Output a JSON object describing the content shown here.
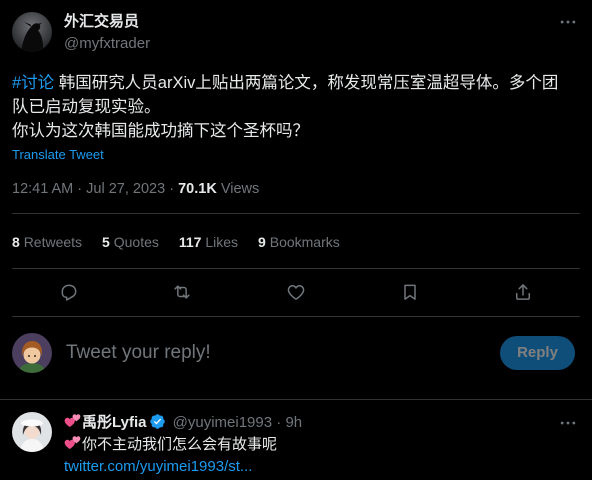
{
  "colors": {
    "background": "#000000",
    "text": "#e7e9ea",
    "secondary": "#71767b",
    "accent": "#1d9bf0",
    "divider": "#2f3336"
  },
  "author": {
    "avatar_icon": "profile-avatar",
    "display_name": "外汇交易员",
    "handle": "@myfxtrader",
    "more_icon": "more-options-icon"
  },
  "tweet": {
    "hashtag": "#讨论",
    "lines": [
      "韩国研究人员arXiv上贴出两篇论文，称发现常压室温超导体。多个团",
      "队已启动复现实验。",
      "你认为这次韩国能成功摘下这个圣杯吗？"
    ],
    "translate_label": "Translate Tweet",
    "time": "12:41 AM",
    "separator": "·",
    "date": "Jul 27, 2023",
    "views_count": "70.1K",
    "views_label": "Views"
  },
  "stats": [
    {
      "count": "8",
      "label": "Retweets"
    },
    {
      "count": "5",
      "label": "Quotes"
    },
    {
      "count": "117",
      "label": "Likes"
    },
    {
      "count": "9",
      "label": "Bookmarks"
    }
  ],
  "actions": [
    "reply-icon",
    "retweet-icon",
    "like-icon",
    "bookmark-icon",
    "share-icon"
  ],
  "composer": {
    "avatar_icon": "my-avatar",
    "placeholder": "Tweet your reply!",
    "button_label": "Reply",
    "button_enabled": false
  },
  "reply": {
    "avatar_icon": "reply-author-avatar",
    "name_icon": "revolving-hearts-emoji",
    "display_name": "禹彤Lyfia",
    "verified_icon": "verified-badge-icon",
    "handle": "@yuyimei1993",
    "separator": "·",
    "time": "9h",
    "more_icon": "more-options-icon",
    "text_icon": "revolving-hearts-emoji",
    "text": "你不主动我们怎么会有故事呢",
    "link": "twitter.com/yuyimei1993/st..."
  }
}
